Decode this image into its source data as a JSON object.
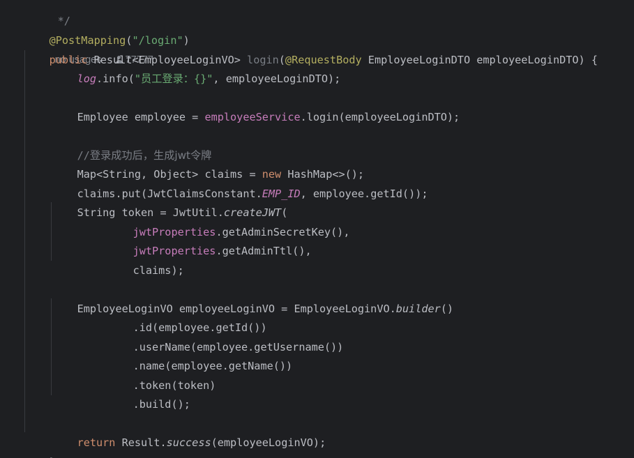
{
  "editor": {
    "top_comment": "*/",
    "annotation_line": {
      "annotation": "@PostMapping",
      "paren_open": "(",
      "path": "\"/login\"",
      "paren_close": ")",
      "usages_hint": "no usages",
      "author_hint": "77777"
    },
    "signature": {
      "kw_public": "public",
      "return_type": " Result<EmployeeLoginVO> ",
      "method": "login",
      "paren_open": "(",
      "param_anno": "@RequestBody",
      "param_rest": " EmployeeLoginDTO employeeLoginDTO) {"
    },
    "log_line": {
      "log": "log",
      "call": ".info(",
      "str_open": "\"",
      "str_text": "员工登录：",
      "str_close": "{}\"",
      "rest": ", employeeLoginDTO);"
    },
    "service_line": {
      "prefix": "Employee employee = ",
      "field": "employeeService",
      "rest": ".login(employeeLoginDTO);"
    },
    "comment_line": {
      "slashes": "//",
      "text": "登录成功后，生成jwt令牌"
    },
    "map_line": {
      "prefix": "Map<String, Object> claims = ",
      "kw_new": "new",
      "rest": " HashMap<>();"
    },
    "put_line": {
      "prefix": "claims.put(JwtClaimsConstant.",
      "static_field": "EMP_ID",
      "rest": ", employee.getId());"
    },
    "token_line": {
      "prefix": "String token = JwtUtil.",
      "static_method": "createJWT",
      "rest": "("
    },
    "secret_line": {
      "field": "jwtProperties",
      "rest": ".getAdminSecretKey(),"
    },
    "ttl_line": {
      "field": "jwtProperties",
      "rest": ".getAdminTtl(),"
    },
    "claims_line": "claims);",
    "builder_line": {
      "prefix": "EmployeeLoginVO employeeLoginVO = EmployeeLoginVO.",
      "static_method": "builder",
      "rest": "()"
    },
    "chain_id": ".id(employee.getId())",
    "chain_username": ".userName(employee.getUsername())",
    "chain_name": ".name(employee.getName())",
    "chain_token": ".token(token)",
    "chain_build": ".build();",
    "return_line": {
      "kw_return": "return",
      "middle": " Result.",
      "static_method": "success",
      "rest": "(employeeLoginVO);"
    },
    "closing_brace": "}"
  }
}
